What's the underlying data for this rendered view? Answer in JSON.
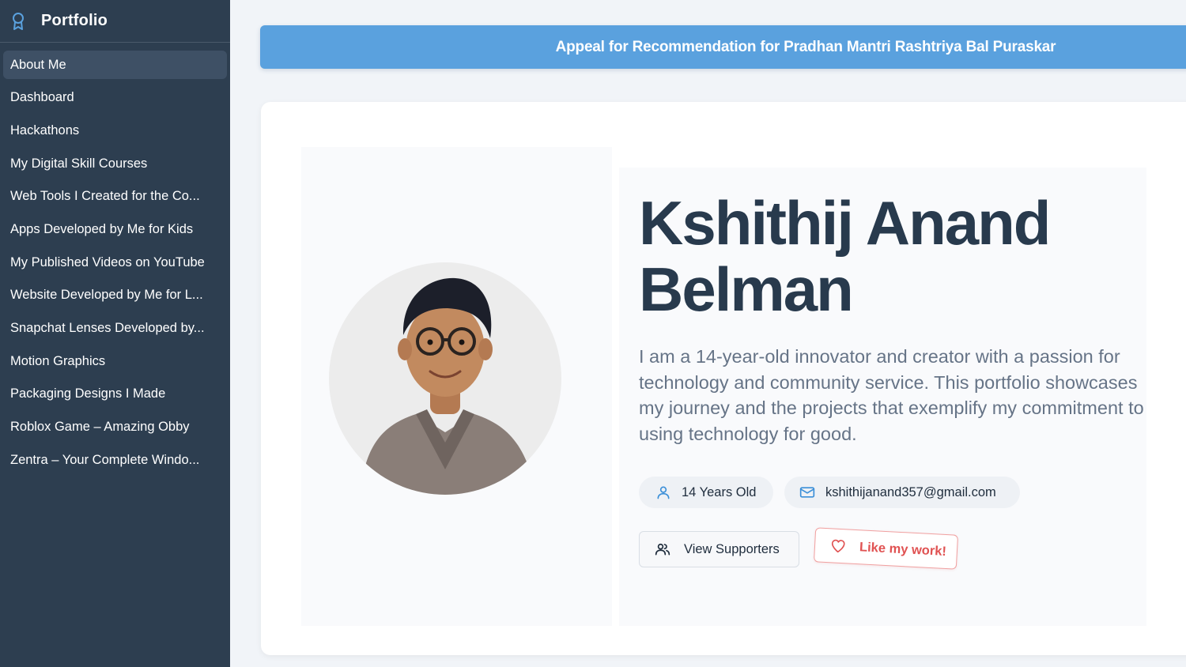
{
  "sidebar": {
    "brand": "Portfolio",
    "brand_icon": "award-ribbon-icon",
    "items": [
      {
        "label": "About Me",
        "active": true
      },
      {
        "label": "Dashboard"
      },
      {
        "label": "Hackathons"
      },
      {
        "label": "My Digital Skill Courses"
      },
      {
        "label": "Web Tools I Created for the Co..."
      },
      {
        "label": "Apps Developed by Me for Kids"
      },
      {
        "label": "My Published Videos on YouTube"
      },
      {
        "label": "Website Developed by Me for L..."
      },
      {
        "label": "Snapchat Lenses Developed by..."
      },
      {
        "label": "Motion Graphics"
      },
      {
        "label": "Packaging Designs I Made"
      },
      {
        "label": "Roblox Game – Amazing Obby"
      },
      {
        "label": "Zentra – Your Complete Windo..."
      }
    ]
  },
  "banner": {
    "text": "Appeal for Recommendation for Pradhan Mantri Rashtriya Bal Puraskar"
  },
  "profile": {
    "name_line1": "Kshithij Anand",
    "name_line2": "Belman",
    "bio": "I am a 14-year-old innovator and creator with a passion for technology and community service. This portfolio showcases my journey and the projects that exemplify my commitment to using technology for good.",
    "age": "14 Years Old",
    "email": "kshithijanand357@gmail.com",
    "supporters_label": "View Supporters",
    "like_label": "Like my work!"
  },
  "colors": {
    "sidebar_bg": "#2d3e50",
    "banner_bg": "#5aa1de",
    "accent_blue": "#3b8fd8",
    "like_red": "#e05252",
    "name_color": "#283a4d"
  }
}
